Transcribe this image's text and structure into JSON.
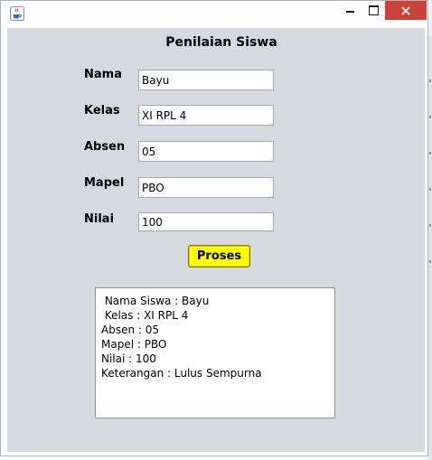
{
  "window": {
    "icon": "java-coffee-icon",
    "controls": [
      "minimize-icon",
      "maximize-icon",
      "close-icon"
    ]
  },
  "form": {
    "title": "Penilaian Siswa",
    "fields": [
      {
        "label": "Nama",
        "value": "Bayu"
      },
      {
        "label": "Kelas",
        "value": "XI RPL 4"
      },
      {
        "label": "Absen",
        "value": "05"
      },
      {
        "label": "Mapel",
        "value": "PBO"
      },
      {
        "label": "Nilai",
        "value": "100"
      }
    ],
    "button_label": "Proses",
    "button_color": "#ffff00"
  },
  "output": {
    "lines": [
      " Nama Siswa : Bayu",
      " Kelas : XI RPL 4",
      "Absen : 05",
      "Mapel : PBO",
      "Nilai : 100",
      "Keterangan : Lulus Sempurna"
    ]
  },
  "colors": {
    "panel": "#d6d9df",
    "close_button": "#c9433a"
  }
}
